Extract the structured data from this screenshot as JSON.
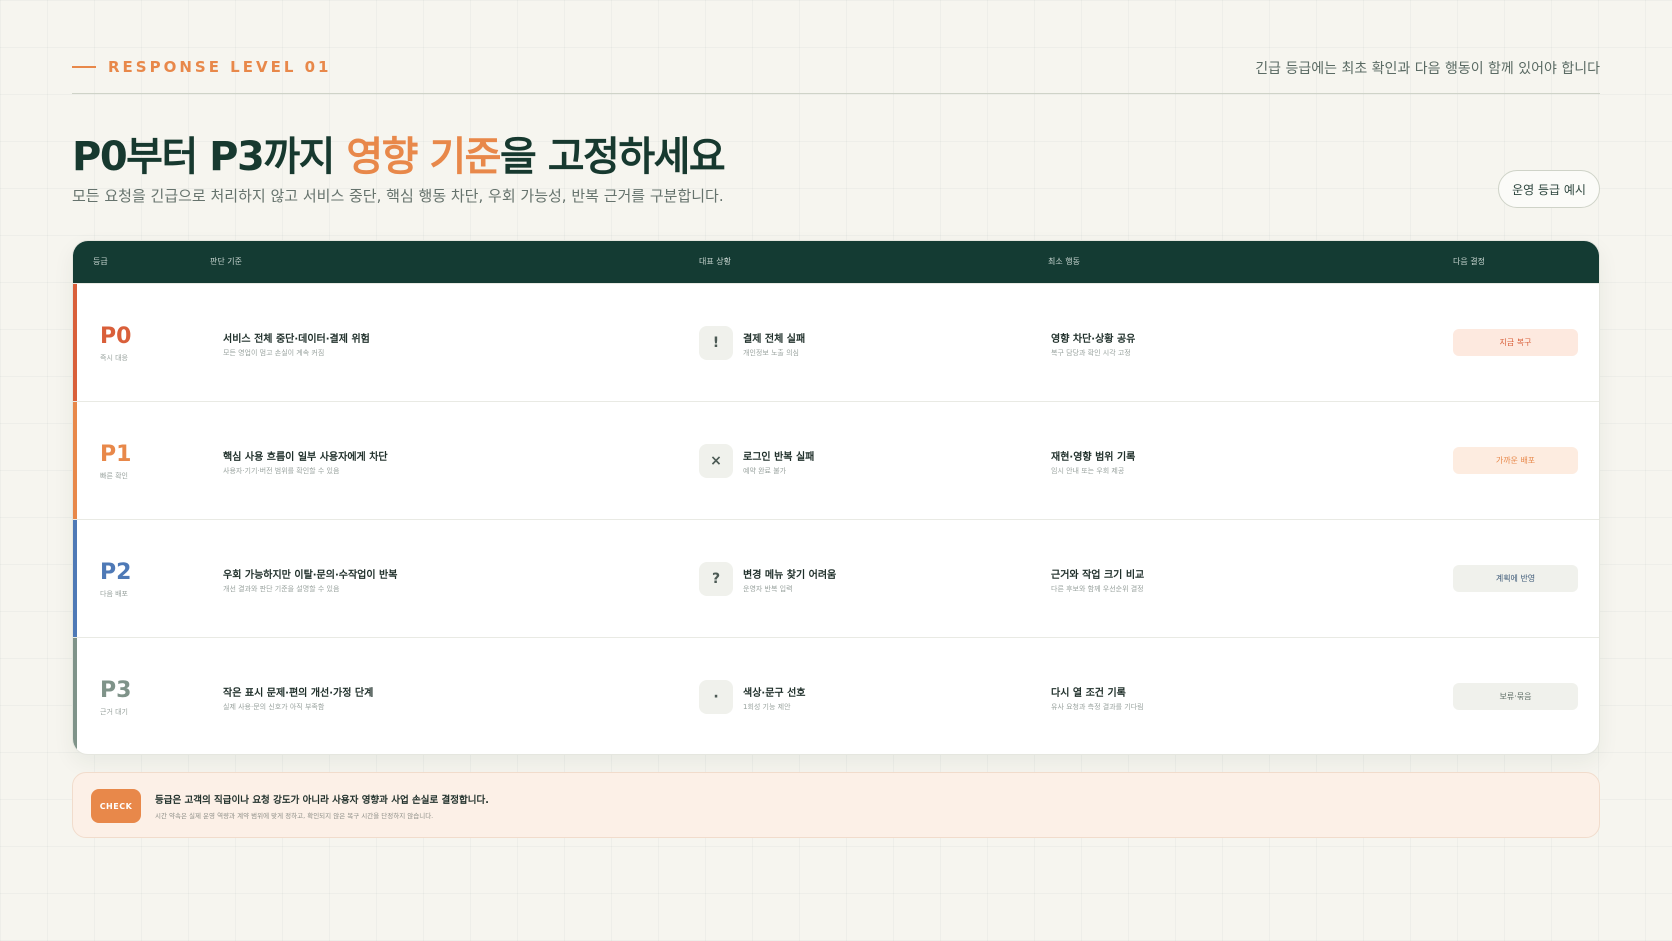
{
  "header": {
    "eyebrow": "RESPONSE LEVEL 01",
    "note": "긴급 등급에는 최초 확인과 다음 행동이 함께 있어야 합니다"
  },
  "title": {
    "part1": "P0부터 P3까지 ",
    "highlight": "영향 기준",
    "part2": "을 고정하세요"
  },
  "subtitle": "모든 요청을 긴급으로 처리하지 않고 서비스 중단, 핵심 행동 차단, 우회 가능성, 반복 근거를 구분합니다.",
  "example_button": "운영 등급 예시",
  "table": {
    "headers": [
      "등급",
      "판단 기준",
      "대표 상황",
      "최소 행동",
      "다음 결정"
    ],
    "rows": [
      {
        "code": "P0",
        "code_sub": "즉시 대응",
        "color": "#d95f3a",
        "criteria": "서비스 전체 중단·데이터·결제 위험",
        "criteria_sub": "모든 영업이 멈고 손실이 계속 커짐",
        "icon": "!",
        "situation": "결제 전체 실패",
        "situation_sub": "개인정보 노출 의심",
        "action": "영향 차단·상황 공유",
        "action_sub": "복구 담당과 확인 시각 고정",
        "decision": "지금 복구",
        "decision_bg": "#fde9df",
        "decision_fg": "#d95f3a"
      },
      {
        "code": "P1",
        "code_sub": "빠른 확인",
        "color": "#e8884a",
        "criteria": "핵심 사용 흐름이 일부 사용자에게 차단",
        "criteria_sub": "사용자·기기·버전 범위를 확인할 수 있음",
        "icon": "×",
        "situation": "로그인 반복 실패",
        "situation_sub": "예약 완료 불가",
        "action": "재현·영향 범위 기록",
        "action_sub": "임시 안내 또는 우회 제공",
        "decision": "가까운 배포",
        "decision_bg": "#fdece0",
        "decision_fg": "#e8884a"
      },
      {
        "code": "P2",
        "code_sub": "다음 배포",
        "color": "#4e79b6",
        "criteria": "우회 가능하지만 이탈·문의·수작업이 반복",
        "criteria_sub": "개선 결과와 판단 기준을 설명할 수 있음",
        "icon": "?",
        "situation": "변경 메뉴 찾기 어려움",
        "situation_sub": "운영자 반복 입력",
        "action": "근거와 작업 크기 비교",
        "action_sub": "다른 후보와 함께 우선순위 결정",
        "decision": "계획에 반영",
        "decision_bg": "#f0f1ec",
        "decision_fg": "#3e5a78"
      },
      {
        "code": "P3",
        "code_sub": "근거 대기",
        "color": "#7f9389",
        "criteria": "작은 표시 문제·편의 개선·가정 단계",
        "criteria_sub": "실제 사용·문의 신호가 아직 부족함",
        "icon": "·",
        "situation": "색상·문구 선호",
        "situation_sub": "1회성 기능 제안",
        "action": "다시 열 조건 기록",
        "action_sub": "유사 요청과 측정 결과를 기다림",
        "decision": "보류·묶음",
        "decision_bg": "#f0f1ec",
        "decision_fg": "#5b6b64"
      }
    ]
  },
  "check": {
    "badge": "CHECK",
    "title": "등급은 고객의 직급이나 요청 강도가 아니라 사용자 영향과 사업 손실로 결정합니다.",
    "sub": "시간 약속은 실제 운영 역량과 계약 범위에 맞게 정하고, 확인되지 않은 복구 시간을 단정하지 않습니다."
  }
}
